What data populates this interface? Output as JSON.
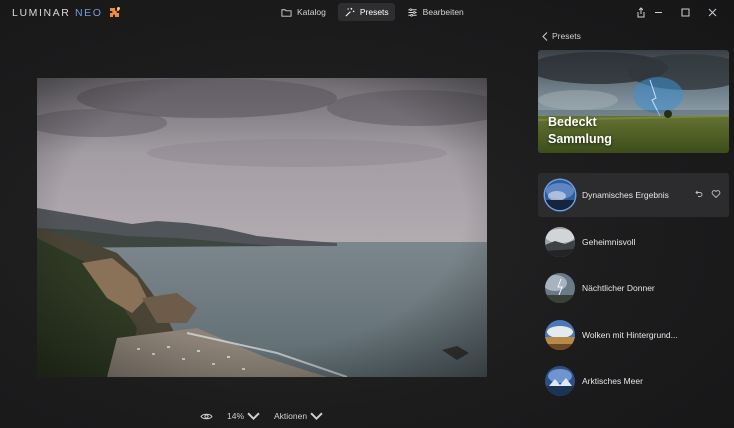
{
  "app": {
    "logo_main": "LUMINAR ",
    "logo_neo": "NEO",
    "accent": "#6e9fd8"
  },
  "nav": {
    "tabs": [
      {
        "label": "Katalog",
        "icon": "folder-icon",
        "active": false
      },
      {
        "label": "Presets",
        "icon": "sparkle-icon",
        "active": true
      },
      {
        "label": "Bearbeiten",
        "icon": "sliders-icon",
        "active": false
      }
    ]
  },
  "window_controls": [
    "share-icon",
    "minimize-icon",
    "maximize-icon",
    "close-icon"
  ],
  "bottom_bar": {
    "eye_icon": "eye-icon",
    "zoom": "14%",
    "actions": "Aktionen"
  },
  "panel": {
    "back_label": "Presets",
    "collection": {
      "title_line1": "Bedeckt",
      "title_line2": "Sammlung"
    },
    "presets": [
      {
        "label": "Dynamisches Ergebnis",
        "active": true
      },
      {
        "label": "Geheimnisvoll",
        "active": false
      },
      {
        "label": "Nächtlicher Donner",
        "active": false
      },
      {
        "label": "Wolken mit Hintergrund...",
        "active": false
      },
      {
        "label": "Arktisches Meer",
        "active": false
      }
    ]
  }
}
